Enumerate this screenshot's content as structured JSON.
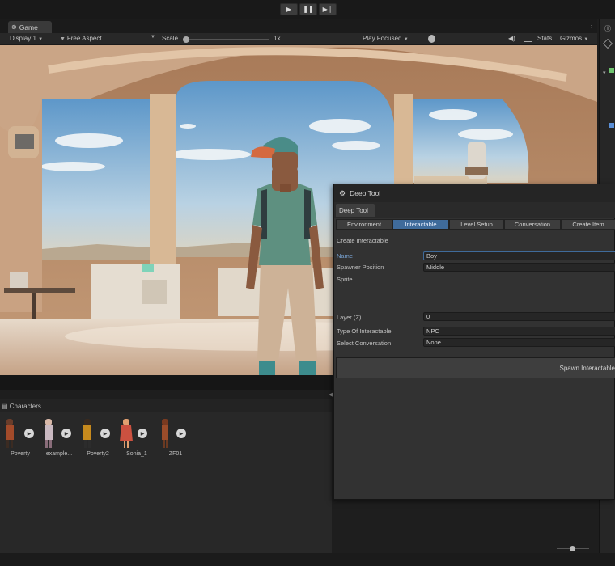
{
  "toolbar": {
    "play_icon": "play-icon",
    "pause_icon": "pause-icon",
    "step_icon": "step-icon"
  },
  "game": {
    "tab_label": "Game",
    "display": "Display 1",
    "aspect": "Free Aspect",
    "scale_label": "Scale",
    "scale_value": "1x",
    "play_mode": "Play Focused",
    "stats": "Stats",
    "gizmos": "Gizmos"
  },
  "characters": {
    "tab_label": "Characters",
    "items": [
      {
        "label": "Poverty",
        "color": "#a34b2a"
      },
      {
        "label": "example...",
        "color": "#c9b9c1"
      },
      {
        "label": "Poverty2",
        "color": "#c78a1d"
      },
      {
        "label": "Sonia_1",
        "color": "#cc5140"
      },
      {
        "label": "ZF01",
        "color": "#9b4c2a"
      }
    ]
  },
  "tool": {
    "title": "Deep Tool",
    "tab": "Deep Tool",
    "sections": [
      "Environment",
      "Interactable",
      "Level Setup",
      "Conversation",
      "Create Item"
    ],
    "active_section": "Interactable",
    "heading": "Create Interactable",
    "fields": {
      "name_label": "Name",
      "name_value": "Boy",
      "spawn_label": "Spawner Position",
      "spawn_value": "Middle",
      "sprite_label": "Sprite",
      "layer_label": "Layer (Z)",
      "layer_value": "0",
      "type_label": "Type Of Interactable",
      "type_value": "NPC",
      "conv_label": "Select Conversation",
      "conv_value": "None"
    },
    "spawn_button": "Spawn Interactable"
  },
  "colors": {
    "accent": "#3f6b9b",
    "panel": "#323232",
    "background": "#1e1e1e"
  }
}
